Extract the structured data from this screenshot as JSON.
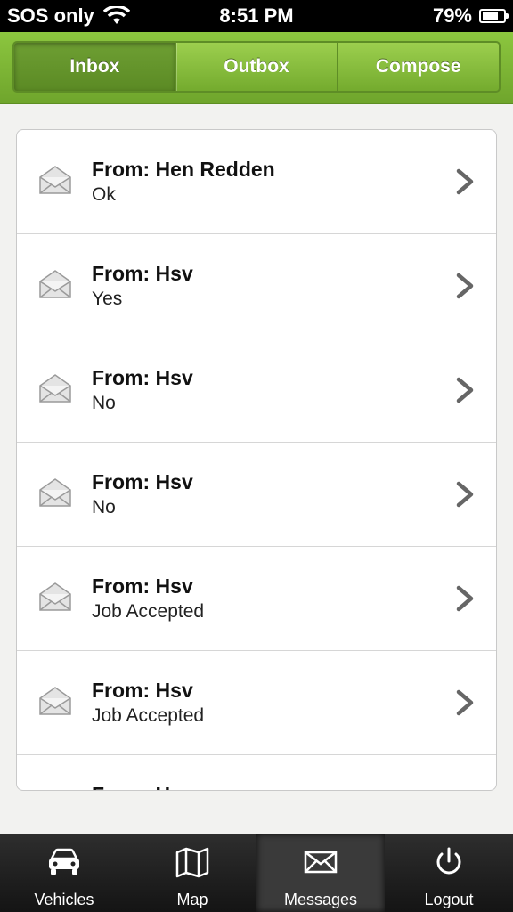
{
  "status_bar": {
    "carrier": "SOS only",
    "time": "8:51 PM",
    "battery": "79%",
    "battery_level": 0.79
  },
  "segments": [
    {
      "label": "Inbox",
      "active": true
    },
    {
      "label": "Outbox",
      "active": false
    },
    {
      "label": "Compose",
      "active": false
    }
  ],
  "messages": [
    {
      "from": "From: Hen Redden",
      "body": "Ok",
      "icon": "envelope-icon"
    },
    {
      "from": "From: Hsv",
      "body": "Yes",
      "icon": "envelope-icon"
    },
    {
      "from": "From: Hsv",
      "body": "No",
      "icon": "envelope-icon"
    },
    {
      "from": "From: Hsv",
      "body": "No",
      "icon": "envelope-icon"
    },
    {
      "from": "From: Hsv",
      "body": "Job Accepted",
      "icon": "envelope-icon"
    },
    {
      "from": "From: Hsv",
      "body": "Job Accepted",
      "icon": "envelope-icon"
    },
    {
      "from": "From: Hsv",
      "body": "",
      "icon": "envelope-icon"
    }
  ],
  "tabs": [
    {
      "label": "Vehicles",
      "icon": "car-icon",
      "active": false
    },
    {
      "label": "Map",
      "icon": "map-icon",
      "active": false
    },
    {
      "label": "Messages",
      "icon": "envelope-icon",
      "active": true
    },
    {
      "label": "Logout",
      "icon": "power-icon",
      "active": false
    }
  ],
  "colors": {
    "header_green": "#8cc63f",
    "tabbar_dark": "#1e1e1e"
  }
}
